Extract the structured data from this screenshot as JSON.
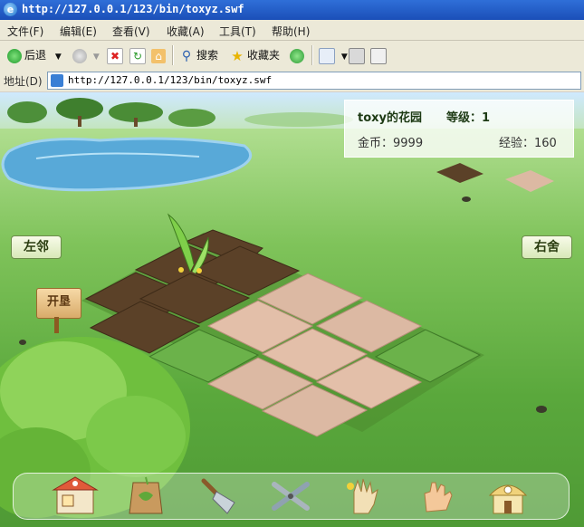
{
  "window": {
    "title": "http://127.0.0.1/123/bin/toxyz.swf"
  },
  "menu": [
    "文件(F)",
    "编辑(E)",
    "查看(V)",
    "收藏(A)",
    "工具(T)",
    "帮助(H)"
  ],
  "toolbar": {
    "back": "后退",
    "search": "搜索",
    "favorites": "收藏夹"
  },
  "address": {
    "label": "地址(D)",
    "url": "http://127.0.0.1/123/bin/toxyz.swf"
  },
  "garden": {
    "title": "toxy的花园",
    "level": "等级：1",
    "gold": "金币：9999",
    "exp": "经验：160"
  },
  "nav": {
    "left": "左邻",
    "right": "右舍"
  },
  "sign": "开垦",
  "tools": [
    {
      "name": "shop-icon"
    },
    {
      "name": "seed-bag-icon"
    },
    {
      "name": "trowel-icon"
    },
    {
      "name": "shears-icon"
    },
    {
      "name": "glove-icon"
    },
    {
      "name": "hand-icon"
    },
    {
      "name": "house-icon"
    }
  ],
  "colors": {
    "tilled": "#5b4128",
    "untilled": "#dcb9a3",
    "grass": "#6bb24a"
  }
}
